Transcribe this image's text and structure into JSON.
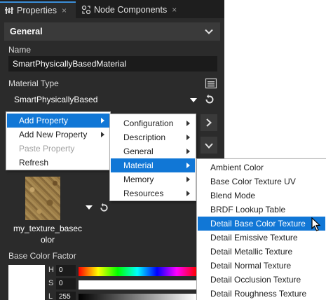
{
  "tabs": [
    {
      "label": "Properties",
      "close": "×",
      "icon": "properties-icon"
    },
    {
      "label": "Node Components",
      "close": "×",
      "icon": "node-components-icon"
    }
  ],
  "section": {
    "title": "General"
  },
  "name": {
    "label": "Name",
    "value": "SmartPhysicallyBasedMaterial"
  },
  "material_type": {
    "label": "Material Type",
    "value": "SmartPhysicallyBased"
  },
  "texture": {
    "label_line1": "my_texture_basec",
    "label_line2": "olor"
  },
  "base_color": {
    "label": "Base Color Factor",
    "h_label": "H",
    "s_label": "S",
    "l_label": "L",
    "h_value": "0",
    "s_value": "0",
    "l_value": "255"
  },
  "context_menu": {
    "items": [
      "Add Property",
      "Add New Property",
      "Paste Property",
      "Refresh"
    ]
  },
  "category_menu": {
    "items": [
      "Configuration",
      "Description",
      "General",
      "Material",
      "Memory",
      "Resources"
    ]
  },
  "property_menu": {
    "items": [
      "Ambient Color",
      "Base Color Texture UV",
      "Blend Mode",
      "BRDF Lookup Table",
      "Detail Base Color Texture",
      "Detail Emissive Texture",
      "Detail Metallic Texture",
      "Detail Normal Texture",
      "Detail Occlusion Texture",
      "Detail Roughness Texture"
    ]
  },
  "colors": {
    "highlight": "#1177d6",
    "panel": "#2b2b2b",
    "accent_tab": "#3b8fd9"
  }
}
